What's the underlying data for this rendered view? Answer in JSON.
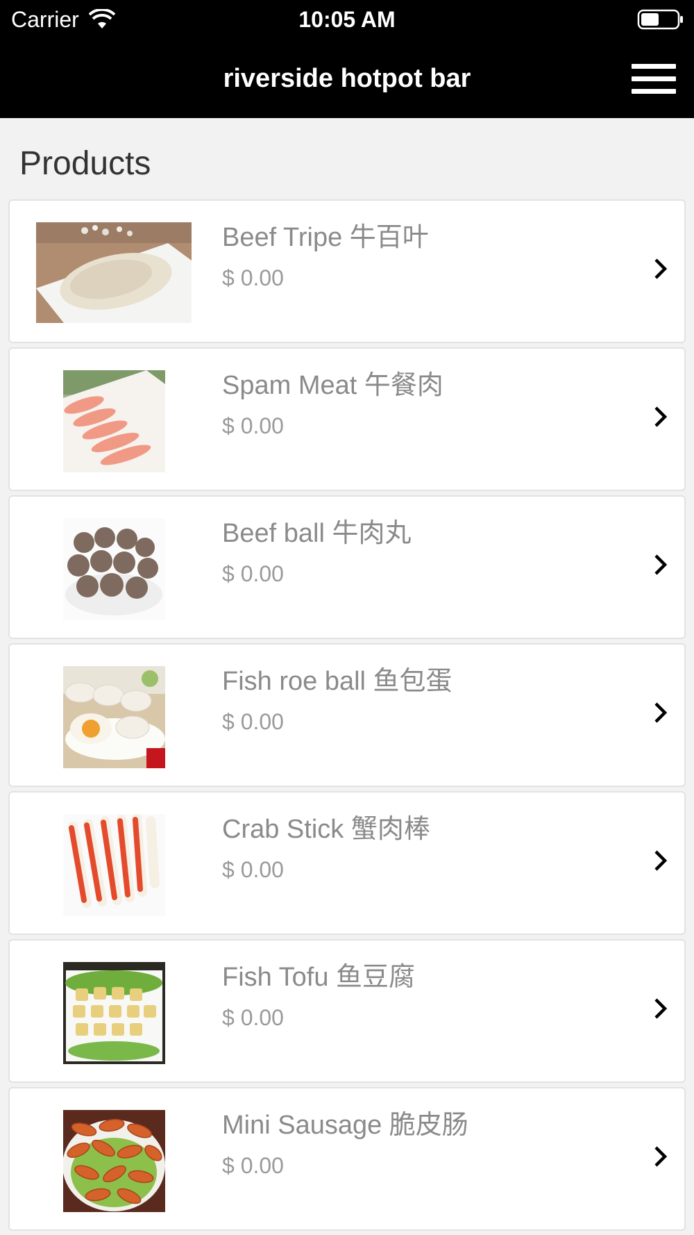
{
  "status_bar": {
    "carrier": "Carrier",
    "time": "10:05 AM"
  },
  "nav": {
    "title": "riverside hotpot bar",
    "menu_icon": "hamburger-menu-icon"
  },
  "section_title": "Products",
  "products": [
    {
      "name": "Beef Tripe 牛百叶",
      "price": "$ 0.00",
      "image": "beef-tripe-photo"
    },
    {
      "name": "Spam Meat 午餐肉",
      "price": "$ 0.00",
      "image": "spam-meat-photo"
    },
    {
      "name": "Beef ball 牛肉丸",
      "price": "$ 0.00",
      "image": "beef-ball-photo"
    },
    {
      "name": "Fish roe ball 鱼包蛋",
      "price": "$ 0.00",
      "image": "fish-roe-ball-photo"
    },
    {
      "name": "Crab Stick 蟹肉棒",
      "price": "$ 0.00",
      "image": "crab-stick-photo"
    },
    {
      "name": "Fish Tofu 鱼豆腐",
      "price": "$ 0.00",
      "image": "fish-tofu-photo"
    },
    {
      "name": "Mini Sausage 脆皮肠",
      "price": "$ 0.00",
      "image": "mini-sausage-photo"
    }
  ],
  "colors": {
    "header_bg": "#000000",
    "page_bg": "#f2f2f2",
    "card_bg": "#ffffff",
    "text_muted": "#8a8a8a"
  }
}
